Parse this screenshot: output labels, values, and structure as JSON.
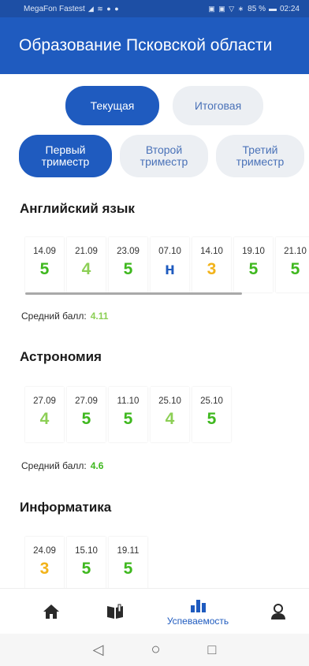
{
  "status_bar": {
    "left": "MegaFon Fastest",
    "icons_left": "◢ ≋ ● ●",
    "icons_right": "▣ ▣ ▽ ∗",
    "battery": "85 %",
    "time": "02:24"
  },
  "app_bar": {
    "title": "Образование Псковской области"
  },
  "mode_tabs": [
    {
      "label": "Текущая",
      "active": true
    },
    {
      "label": "Итоговая",
      "active": false
    }
  ],
  "period_tabs": [
    {
      "line1": "Первый",
      "line2": "триместр",
      "active": true
    },
    {
      "line1": "Второй",
      "line2": "триместр",
      "active": false
    },
    {
      "line1": "Третий",
      "line2": "триместр",
      "active": false
    }
  ],
  "average_label": "Средний балл:",
  "subjects": [
    {
      "name": "Английский язык",
      "average": "4.11",
      "grades": [
        {
          "date": "14.09",
          "mark": "5"
        },
        {
          "date": "21.09",
          "mark": "4"
        },
        {
          "date": "23.09",
          "mark": "5"
        },
        {
          "date": "07.10",
          "mark": "н"
        },
        {
          "date": "14.10",
          "mark": "3"
        },
        {
          "date": "19.10",
          "mark": "5"
        },
        {
          "date": "21.10",
          "mark": "5"
        }
      ]
    },
    {
      "name": "Астрономия",
      "average": "4.6",
      "grades": [
        {
          "date": "27.09",
          "mark": "4"
        },
        {
          "date": "27.09",
          "mark": "5"
        },
        {
          "date": "11.10",
          "mark": "5"
        },
        {
          "date": "25.10",
          "mark": "4"
        },
        {
          "date": "25.10",
          "mark": "5"
        }
      ]
    },
    {
      "name": "Информатика",
      "grades": [
        {
          "date": "24.09",
          "mark": "3"
        },
        {
          "date": "15.10",
          "mark": "5"
        },
        {
          "date": "19.11",
          "mark": "5"
        }
      ]
    }
  ],
  "colors": {
    "primary": "#1f5bbf",
    "mark_5": "#3fb81f",
    "mark_4": "#8ccf55",
    "mark_3": "#f2b31a",
    "mark_absent": "#1f5bbf"
  },
  "bottom_nav": [
    {
      "icon": "home-icon",
      "label": ""
    },
    {
      "icon": "diary-icon",
      "label": ""
    },
    {
      "icon": "performance-icon",
      "label": "Успеваемость",
      "active": true
    },
    {
      "icon": "profile-icon",
      "label": ""
    }
  ],
  "system_nav": {
    "back": "◁",
    "home": "○",
    "recents": "□"
  }
}
